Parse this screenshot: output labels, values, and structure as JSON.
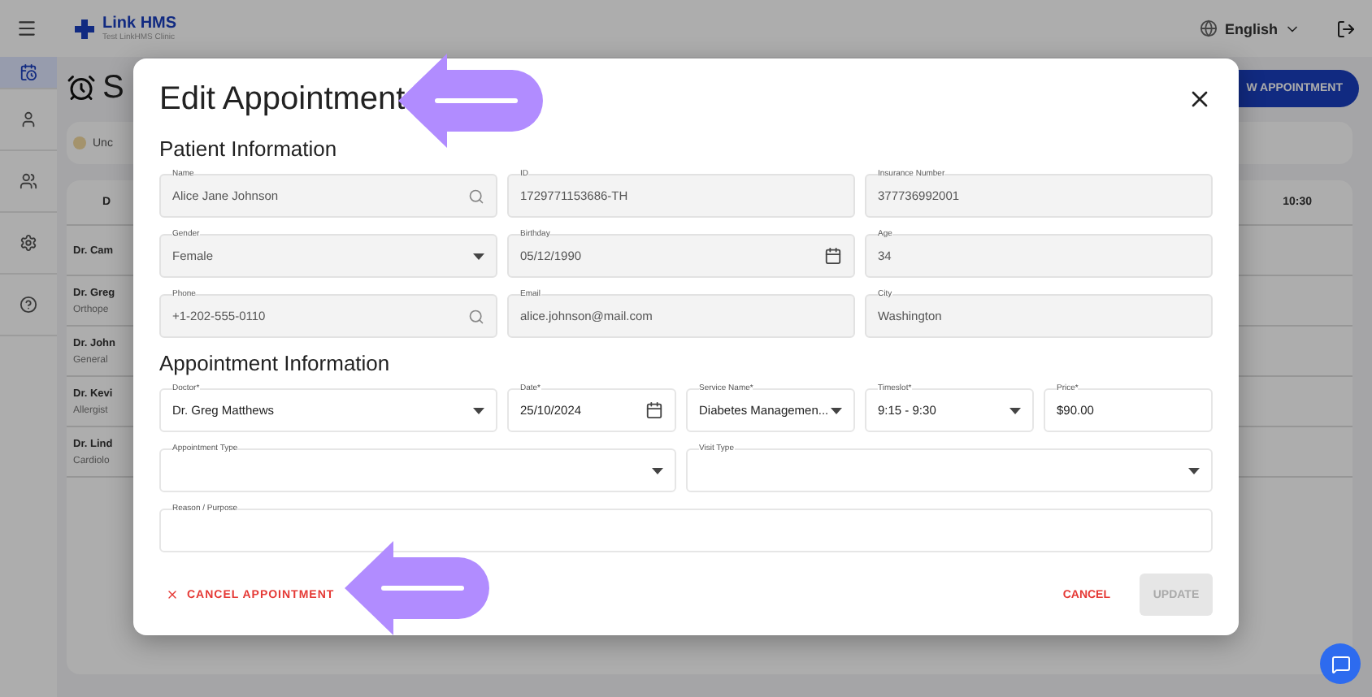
{
  "app": {
    "brand": "Link HMS",
    "clinic": "Test LinkHMS Clinic",
    "language": "English"
  },
  "sidebar": {
    "items": [
      {
        "kind": "calendar",
        "selected": true
      },
      {
        "kind": "person",
        "selected": false
      },
      {
        "kind": "group",
        "selected": false
      },
      {
        "kind": "gear",
        "selected": false
      },
      {
        "kind": "help",
        "selected": false
      }
    ]
  },
  "page": {
    "title": "S",
    "filter_chip": "Unc",
    "new_button": "W APPOINTMENT",
    "columns": [
      "D",
      "10:30"
    ],
    "rows": [
      {
        "doctor": "Dr. Cam"
      },
      {
        "doctor": "Dr. Greg",
        "specialty": "Orthope"
      },
      {
        "doctor": "Dr. John",
        "specialty": "General"
      },
      {
        "doctor": "Dr. Kevi",
        "specialty": "Allergist"
      },
      {
        "doctor": "Dr. Lind",
        "specialty": "Cardiolo"
      }
    ]
  },
  "dialog": {
    "title": "Edit Appointment",
    "sections": [
      {
        "title": "Patient Information",
        "lines": [
          {
            "fields": [
              {
                "label": "Name",
                "value": "Alice Jane Johnson",
                "kind": "search",
                "disabled": true
              },
              {
                "label": "ID",
                "value": "1729771153686-TH",
                "kind": "text",
                "disabled": true
              },
              {
                "label": "Insurance Number",
                "value": "377736992001",
                "kind": "text",
                "disabled": true
              }
            ]
          },
          {
            "fields": [
              {
                "label": "Gender",
                "value": "Female",
                "kind": "select",
                "disabled": true
              },
              {
                "label": "Birthday",
                "value": "05/12/1990",
                "kind": "date",
                "disabled": true
              },
              {
                "label": "Age",
                "value": "34",
                "kind": "text",
                "disabled": true
              }
            ]
          },
          {
            "fields": [
              {
                "label": "Phone",
                "value": "+1-202-555-0110",
                "kind": "search",
                "disabled": true
              },
              {
                "label": "Email",
                "value": "alice.johnson@mail.com",
                "kind": "text",
                "disabled": true
              },
              {
                "label": "City",
                "value": "Washington",
                "kind": "text",
                "disabled": true
              }
            ]
          }
        ]
      },
      {
        "title": "Appointment Information",
        "lines": [
          {
            "fields": [
              {
                "label": "Doctor*",
                "value": "Dr. Greg Matthews",
                "kind": "select",
                "disabled": false
              },
              {
                "label": "Date*",
                "value": "25/10/2024",
                "kind": "date",
                "disabled": false
              },
              {
                "label": "Service Name*",
                "value": "Diabetes Managemen...",
                "kind": "select",
                "disabled": false
              },
              {
                "label": "Timeslot*",
                "value": "9:15 - 9:30",
                "kind": "select",
                "disabled": false
              },
              {
                "label": "Price*",
                "value": "$90.00",
                "kind": "text",
                "disabled": false
              }
            ]
          },
          {
            "fields": [
              {
                "label": "Appointment Type",
                "kind": "select",
                "disabled": false
              },
              {
                "label": "Visit Type",
                "kind": "select",
                "disabled": false
              }
            ]
          },
          {
            "fields": [
              {
                "label": "Reason / Purpose",
                "kind": "text",
                "disabled": false
              }
            ]
          }
        ]
      }
    ],
    "cancel_appointment": "CANCEL APPOINTMENT",
    "cancel": "CANCEL",
    "update": {
      "label": "UPDATE",
      "disabled": true
    }
  }
}
